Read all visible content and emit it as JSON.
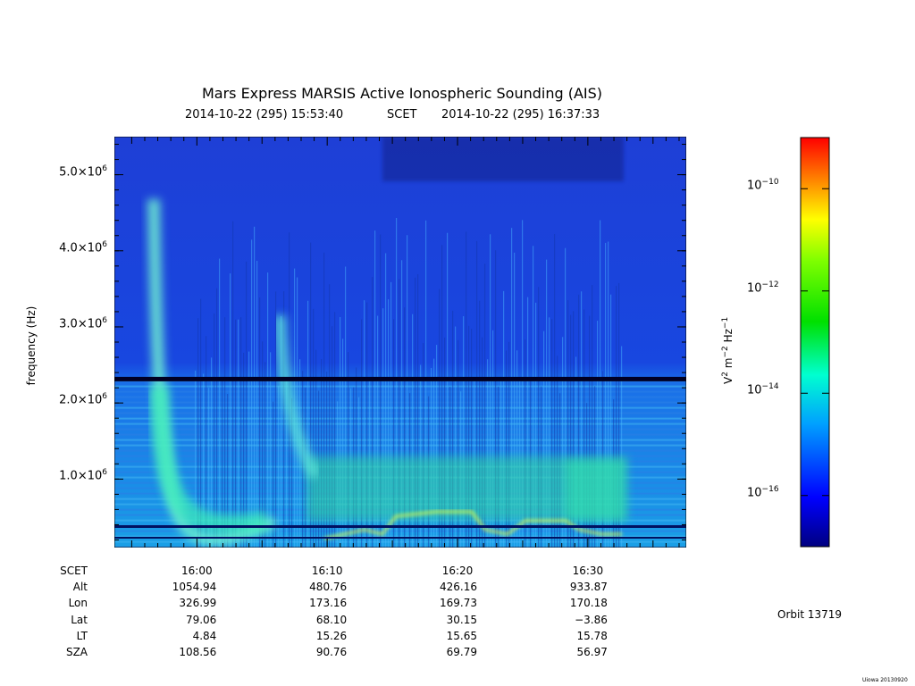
{
  "chart_data": {
    "type": "heatmap",
    "title": "Mars Express MARSIS Active Ionospheric Sounding (AIS)",
    "subtitle": {
      "start": "2014-10-22 (295) 15:53:40",
      "mid": "SCET",
      "end": "2014-10-22 (295) 16:37:33"
    },
    "ylabel": "frequency (Hz)",
    "yticks": [
      {
        "mant": "1.0×10",
        "exp": "6",
        "value": 1000000
      },
      {
        "mant": "2.0×10",
        "exp": "6",
        "value": 2000000
      },
      {
        "mant": "3.0×10",
        "exp": "6",
        "value": 3000000
      },
      {
        "mant": "4.0×10",
        "exp": "6",
        "value": 4000000
      },
      {
        "mant": "5.0×10",
        "exp": "6",
        "value": 5000000
      }
    ],
    "ylim": [
      100000,
      5500000
    ],
    "xlim_minutes": [
      0,
      43.88
    ],
    "colorbar": {
      "label_base": "V",
      "label_mid": "m",
      "label_end": "Hz",
      "label_sup1": "2",
      "label_sup2": "−2",
      "label_sup3": "−1",
      "ticks": [
        {
          "mant": "10",
          "exp": "−10",
          "value": -10
        },
        {
          "mant": "10",
          "exp": "−12",
          "value": -12
        },
        {
          "mant": "10",
          "exp": "−14",
          "value": -14
        },
        {
          "mant": "10",
          "exp": "−16",
          "value": -16
        }
      ],
      "range": [
        -17.0,
        -9.0
      ]
    },
    "features": {
      "plasma_line_freq": 2320000,
      "strong_ionospheric_echo_minutes": [
        6.3,
        38.5
      ]
    }
  },
  "table": {
    "row_labels": [
      "SCET",
      "Alt",
      "Lon",
      "Lat",
      "LT",
      "SZA"
    ],
    "columns": [
      {
        "minute": 6.33,
        "values": [
          "16:00",
          "1054.94",
          "326.99",
          "79.06",
          "4.84",
          "108.56"
        ]
      },
      {
        "minute": 16.33,
        "values": [
          "16:10",
          "480.76",
          "173.16",
          "68.10",
          "15.26",
          "90.76"
        ]
      },
      {
        "minute": 26.33,
        "values": [
          "16:20",
          "426.16",
          "169.73",
          "30.15",
          "15.65",
          "69.79"
        ]
      },
      {
        "minute": 36.33,
        "values": [
          "16:30",
          "933.87",
          "170.18",
          "−3.86",
          "15.78",
          "56.97"
        ]
      }
    ]
  },
  "orbit": "Orbit 13719",
  "credit": "Uiowa 20130920"
}
